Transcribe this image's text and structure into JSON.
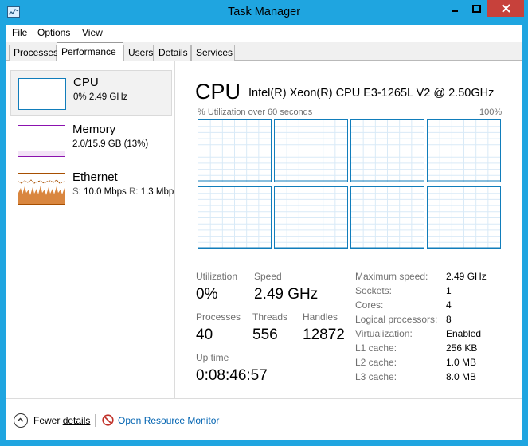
{
  "window": {
    "title": "Task Manager",
    "accent": "#1fa5e0",
    "close_color": "#c7413b"
  },
  "menu": [
    "File",
    "Options",
    "View"
  ],
  "tabs": [
    {
      "label": "Processes",
      "active": false
    },
    {
      "label": "Performance",
      "active": true
    },
    {
      "label": "Users",
      "active": false
    },
    {
      "label": "Details",
      "active": false
    },
    {
      "label": "Services",
      "active": false
    }
  ],
  "sidebar": {
    "items": [
      {
        "title": "CPU",
        "subtitle": "0% 2.49 GHz",
        "color": "#117dbb"
      },
      {
        "title": "Memory",
        "subtitle": "2.0/15.9 GB (13%)",
        "color": "#8b12ae"
      },
      {
        "title": "Ethernet",
        "send_label": "S:",
        "send_value": "10.0 Mbps",
        "recv_label": "R:",
        "recv_value": "1.3 Mbp",
        "color": "#a74f01"
      }
    ]
  },
  "cpu": {
    "heading": "CPU",
    "model": "Intel(R) Xeon(R) CPU E3-1265L V2 @ 2.50GHz",
    "graph_caption": "% Utilization over 60 seconds",
    "graph_max": "100%",
    "graph_color": "#117dbb",
    "logical_graphs": 8,
    "stats": {
      "utilization_label": "Utilization",
      "utilization_value": "0%",
      "speed_label": "Speed",
      "speed_value": "2.49 GHz",
      "processes_label": "Processes",
      "processes_value": "40",
      "threads_label": "Threads",
      "threads_value": "556",
      "handles_label": "Handles",
      "handles_value": "12872",
      "uptime_label": "Up time",
      "uptime_value": "0:08:46:57"
    },
    "specs": [
      {
        "label": "Maximum speed:",
        "value": "2.49 GHz"
      },
      {
        "label": "Sockets:",
        "value": "1"
      },
      {
        "label": "Cores:",
        "value": "4"
      },
      {
        "label": "Logical processors:",
        "value": "8"
      },
      {
        "label": "Virtualization:",
        "value": "Enabled"
      },
      {
        "label": "L1 cache:",
        "value": "256 KB"
      },
      {
        "label": "L2 cache:",
        "value": "1.0 MB"
      },
      {
        "label": "L3 cache:",
        "value": "8.0 MB"
      }
    ]
  },
  "footer": {
    "fewer_details_pre": "Fewer ",
    "fewer_details_underlined": "details",
    "resource_monitor": "Open Resource Monitor"
  }
}
